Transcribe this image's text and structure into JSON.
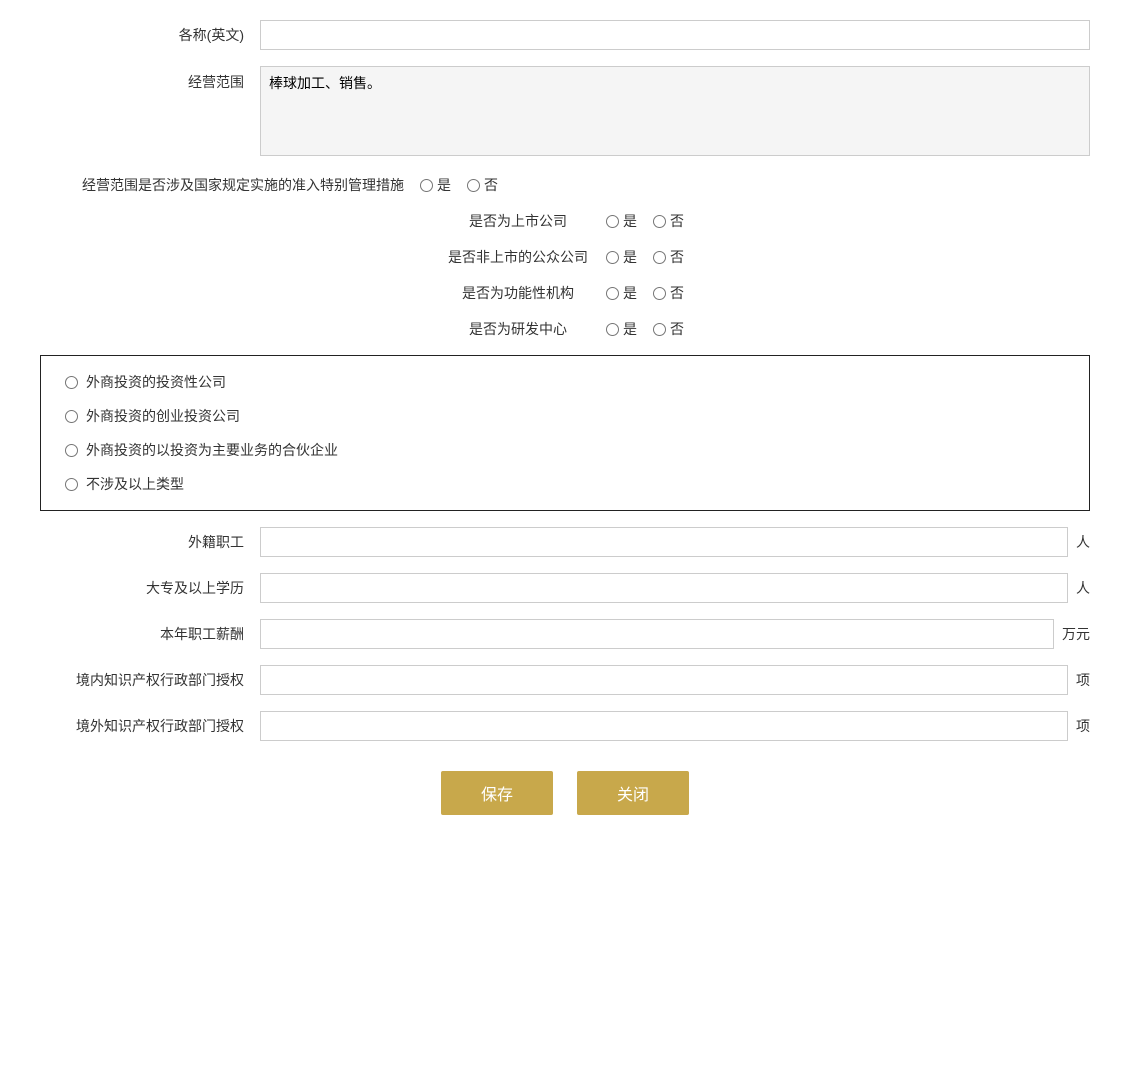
{
  "fields": {
    "name_en_label": "各称(英文)",
    "business_scope_label": "经营范围",
    "business_scope_value": "棒球加工、销售。",
    "special_management_label": "经营范围是否涉及国家规定实施的准入特别管理措施",
    "listed_company_label": "是否为上市公司",
    "non_listed_public_label": "是否非上市的公众公司",
    "functional_institution_label": "是否为功能性机构",
    "rd_center_label": "是否为研发中心",
    "yes_label": "是",
    "no_label": "否",
    "foreign_employees_label": "外籍职工",
    "foreign_employees_unit": "人",
    "college_degree_label": "大专及以上学历",
    "college_degree_unit": "人",
    "annual_salary_label": "本年职工薪酬",
    "annual_salary_unit": "万元",
    "domestic_ip_label": "境内知识产权行政部门授权",
    "domestic_ip_unit": "项",
    "foreign_ip_label": "境外知识产权行政部门授权",
    "foreign_ip_unit": "项"
  },
  "investment_options": [
    "外商投资的投资性公司",
    "外商投资的创业投资公司",
    "外商投资的以投资为主要业务的合伙企业",
    "不涉及以上类型"
  ],
  "buttons": {
    "save": "保存",
    "close": "关闭"
  }
}
